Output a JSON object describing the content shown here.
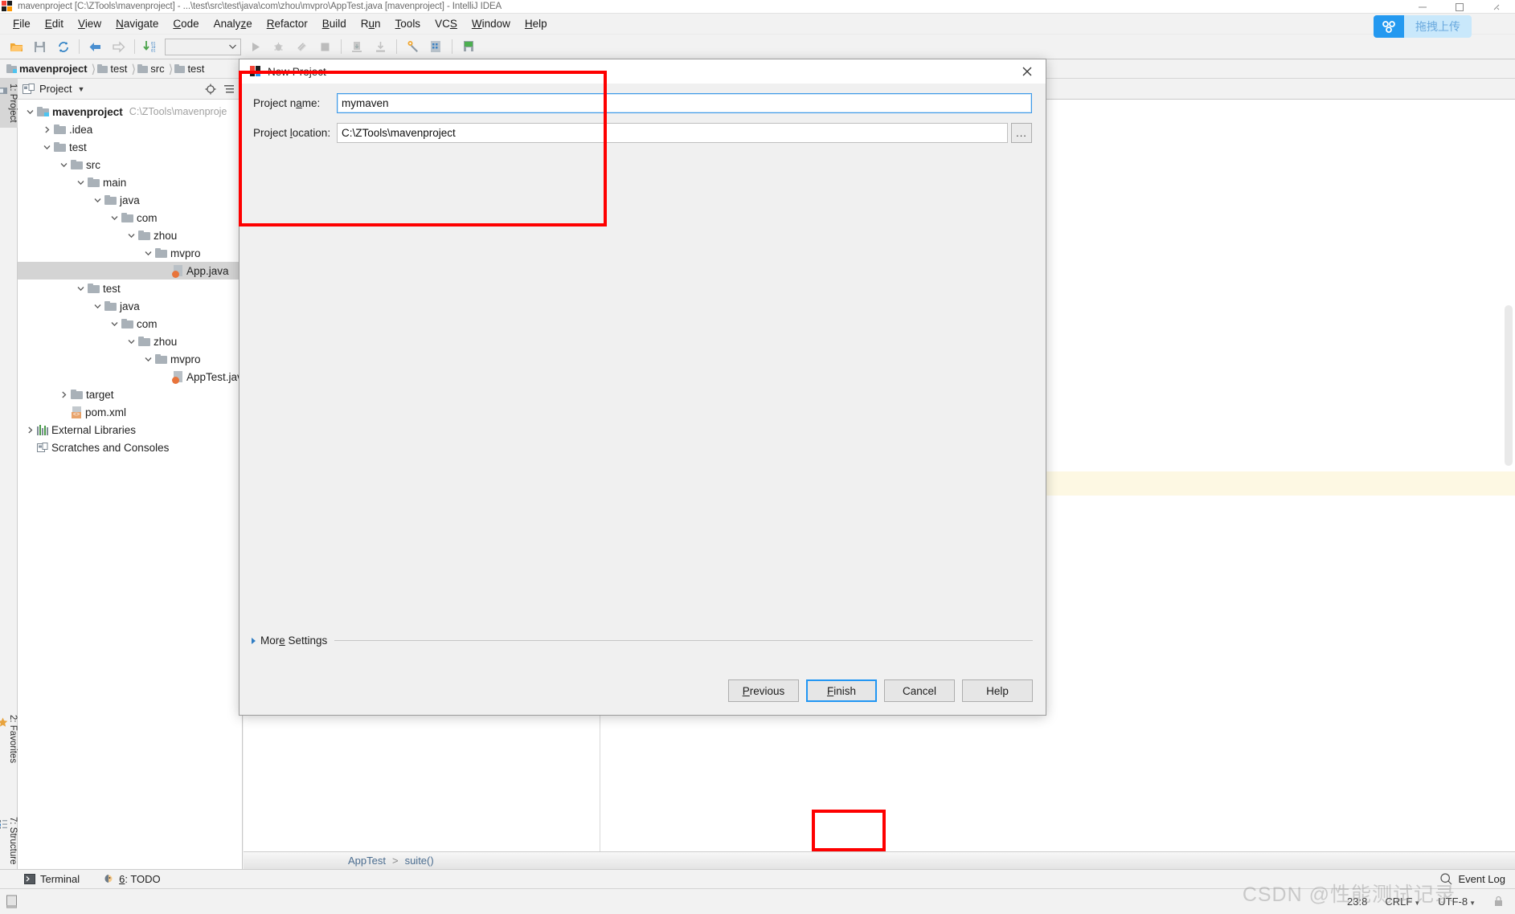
{
  "window": {
    "title": "mavenproject [C:\\ZTools\\mavenproject] - ...\\test\\src\\test\\java\\com\\zhou\\mvpro\\AppTest.java [mavenproject] - IntelliJ IDEA",
    "minimize_label": "Minimize",
    "maximize_label": "Maximize",
    "close_label": "Close"
  },
  "menubar": {
    "items": [
      {
        "label": "File"
      },
      {
        "label": "Edit"
      },
      {
        "label": "View"
      },
      {
        "label": "Navigate"
      },
      {
        "label": "Code"
      },
      {
        "label": "Analyze"
      },
      {
        "label": "Refactor"
      },
      {
        "label": "Build"
      },
      {
        "label": "Run"
      },
      {
        "label": "Tools"
      },
      {
        "label": "VCS"
      },
      {
        "label": "Window"
      },
      {
        "label": "Help"
      }
    ]
  },
  "toolbar": {
    "icons": [
      "open-folder-icon",
      "save-all-icon",
      "sync-icon",
      "back-arrow-icon",
      "forward-arrow-icon",
      "compile-icon",
      "run-configurations-select",
      "run-icon",
      "debug-icon",
      "coverage-icon",
      "stop-icon",
      "update-project-icon",
      "commit-icon",
      "settings-wrench-icon",
      "project-structure-icon",
      "sdk-manager-icon"
    ],
    "run_config_value": ""
  },
  "breadcrumb": {
    "items": [
      {
        "label": "mavenproject",
        "bold": true
      },
      {
        "label": "test",
        "bold": false
      },
      {
        "label": "src",
        "bold": false
      },
      {
        "label": "test",
        "bold": false
      }
    ]
  },
  "tool_tabs": {
    "left": [
      {
        "label": "1: Project",
        "selected": true,
        "icon": "project-icon"
      },
      {
        "label": "2: Favorites",
        "selected": false,
        "icon": "star-icon"
      },
      {
        "label": "7: Structure",
        "selected": false,
        "icon": "structure-icon"
      }
    ]
  },
  "project_panel": {
    "title": "Project",
    "dropdown_icon": "chevron-down-icon",
    "header_icons": [
      "target-locate-icon",
      "collapse-all-icon"
    ],
    "tree": [
      {
        "indent": 0,
        "twisty": "down",
        "icon": "module-folder",
        "label": "mavenproject",
        "bold": true,
        "path": "C:\\ZTools\\mavenproje",
        "selected": false
      },
      {
        "indent": 1,
        "twisty": "right",
        "icon": "folder",
        "label": ".idea",
        "bold": false,
        "path": "",
        "selected": false
      },
      {
        "indent": 1,
        "twisty": "down",
        "icon": "folder",
        "label": "test",
        "bold": false,
        "path": "",
        "selected": false
      },
      {
        "indent": 2,
        "twisty": "down",
        "icon": "folder",
        "label": "src",
        "bold": false,
        "path": "",
        "selected": false
      },
      {
        "indent": 3,
        "twisty": "down",
        "icon": "folder",
        "label": "main",
        "bold": false,
        "path": "",
        "selected": false
      },
      {
        "indent": 4,
        "twisty": "down",
        "icon": "folder",
        "label": "java",
        "bold": false,
        "path": "",
        "selected": false
      },
      {
        "indent": 5,
        "twisty": "down",
        "icon": "folder",
        "label": "com",
        "bold": false,
        "path": "",
        "selected": false
      },
      {
        "indent": 6,
        "twisty": "down",
        "icon": "folder",
        "label": "zhou",
        "bold": false,
        "path": "",
        "selected": false
      },
      {
        "indent": 7,
        "twisty": "down",
        "icon": "folder",
        "label": "mvpro",
        "bold": false,
        "path": "",
        "selected": false
      },
      {
        "indent": 8,
        "twisty": "none",
        "icon": "java-file",
        "label": "App.java",
        "bold": false,
        "path": "",
        "selected": true
      },
      {
        "indent": 3,
        "twisty": "down",
        "icon": "folder",
        "label": "test",
        "bold": false,
        "path": "",
        "selected": false
      },
      {
        "indent": 4,
        "twisty": "down",
        "icon": "folder",
        "label": "java",
        "bold": false,
        "path": "",
        "selected": false
      },
      {
        "indent": 5,
        "twisty": "down",
        "icon": "folder",
        "label": "com",
        "bold": false,
        "path": "",
        "selected": false
      },
      {
        "indent": 6,
        "twisty": "down",
        "icon": "folder",
        "label": "zhou",
        "bold": false,
        "path": "",
        "selected": false
      },
      {
        "indent": 7,
        "twisty": "down",
        "icon": "folder",
        "label": "mvpro",
        "bold": false,
        "path": "",
        "selected": false
      },
      {
        "indent": 8,
        "twisty": "none",
        "icon": "java-file",
        "label": "AppTest.java",
        "bold": false,
        "path": "",
        "selected": false
      },
      {
        "indent": 2,
        "twisty": "right",
        "icon": "folder",
        "label": "target",
        "bold": false,
        "path": "",
        "selected": false
      },
      {
        "indent": 2,
        "twisty": "none",
        "icon": "xml-file",
        "label": "pom.xml",
        "bold": false,
        "path": "",
        "selected": false
      },
      {
        "indent": 0,
        "twisty": "right",
        "icon": "libraries",
        "label": "External Libraries",
        "bold": false,
        "path": "",
        "selected": false
      },
      {
        "indent": 0,
        "twisty": "none",
        "icon": "scratches",
        "label": "Scratches and Consoles",
        "bold": false,
        "path": "",
        "selected": false
      }
    ]
  },
  "editor": {
    "breadcrumb": [
      "AppTest",
      "suite()"
    ],
    "separator": ">"
  },
  "dialog": {
    "title": "New Project",
    "icon": "intellij-logo-icon",
    "close_icon": "close-icon",
    "fields": [
      {
        "label_pre": "Project n",
        "label_key": "a",
        "label_post": "me:",
        "value": "mymaven",
        "focused": true,
        "has_browse": false
      },
      {
        "label_pre": "Project ",
        "label_key": "l",
        "label_post": "ocation:",
        "value": "C:\\ZTools\\mavenproject",
        "focused": false,
        "has_browse": true
      }
    ],
    "browse_label": "...",
    "more_settings": {
      "pre": "Mor",
      "key": "e",
      "post": " Settings"
    },
    "buttons": [
      {
        "pre": "",
        "key": "P",
        "post": "revious",
        "default": false
      },
      {
        "pre": "",
        "key": "F",
        "post": "inish",
        "default": true
      },
      {
        "pre": "Cancel",
        "key": "",
        "post": "",
        "default": false
      },
      {
        "pre": "Help",
        "key": "",
        "post": "",
        "default": false
      }
    ]
  },
  "bottom_tools": [
    {
      "icon": "terminal-icon",
      "pre": "Terminal",
      "key": "",
      "post": ""
    },
    {
      "icon": "todo-icon",
      "pre": "",
      "key": "6",
      "post": ": TODO"
    }
  ],
  "event_log": {
    "label": "Event Log",
    "icon": "search-circle-icon"
  },
  "status_bar": {
    "caret_position": "23:8",
    "line_separator": "CRLF",
    "encoding": "UTF-8",
    "lock_icon": "lock-icon",
    "memory_icon": "memory-indicator"
  },
  "baidu_widget": {
    "label": "拖拽上传",
    "icon": "baidu-netdisk-icon",
    "accent": "#2499f0"
  },
  "watermark": "CSDN @性能测试记录",
  "annotations": {
    "accent": "#fe0000",
    "boxes": [
      {
        "name": "fields-highlight"
      },
      {
        "name": "finish-highlight"
      }
    ]
  }
}
